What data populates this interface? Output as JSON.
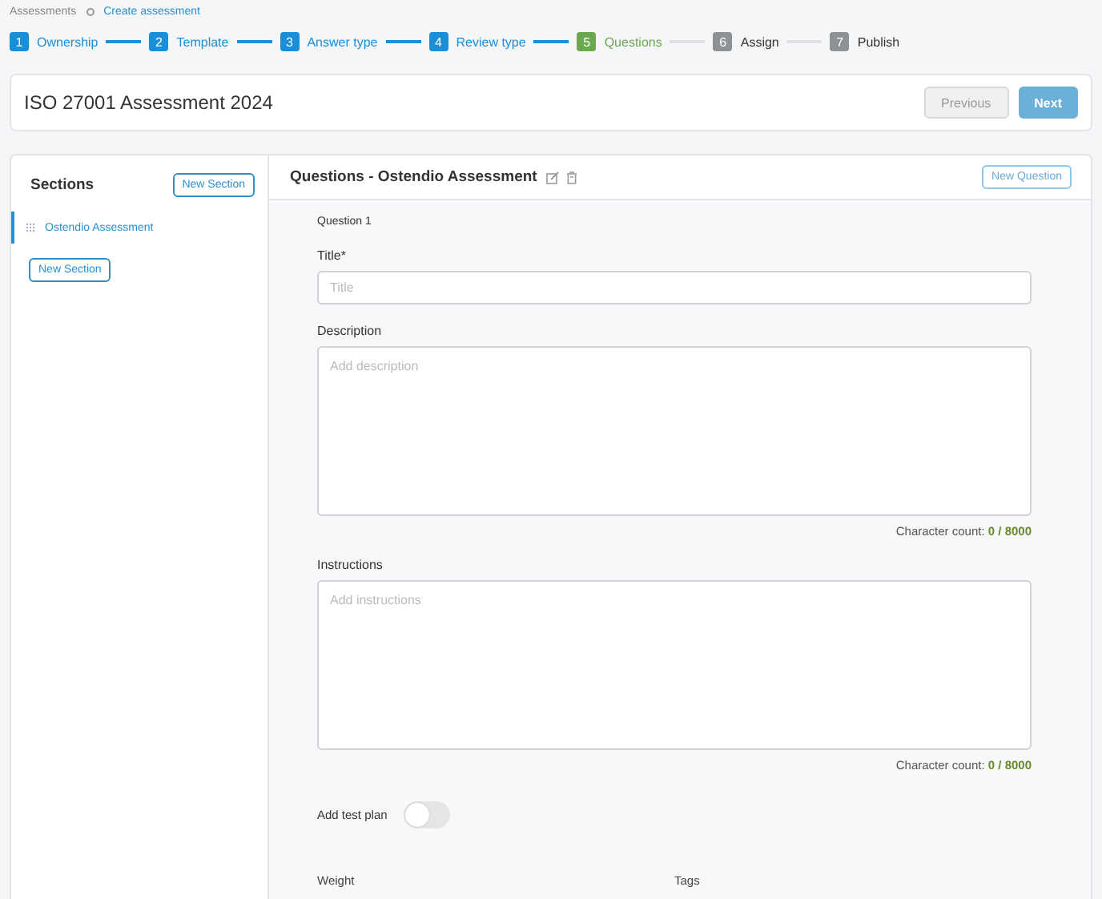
{
  "breadcrumb": [
    {
      "label": "Assessments",
      "kind": "link_muted"
    },
    {
      "label": "Create assessment",
      "kind": "link"
    }
  ],
  "steps": [
    {
      "number": "1",
      "label": "Ownership",
      "kind": "done"
    },
    {
      "number": "2",
      "label": "Template",
      "kind": "done"
    },
    {
      "number": "3",
      "label": "Answer type",
      "kind": "done"
    },
    {
      "number": "4",
      "label": "Review type",
      "kind": "done"
    },
    {
      "number": "5",
      "label": "Questions",
      "kind": "current"
    },
    {
      "number": "6",
      "label": "Assign",
      "kind": "pending"
    },
    {
      "number": "7",
      "label": "Publish",
      "kind": "pending"
    }
  ],
  "header": {
    "title": "ISO 27001 Assessment 2024",
    "buttons": [
      {
        "label": "Previous",
        "kind": "secondary",
        "disabled": true
      },
      {
        "label": "Next",
        "kind": "primary",
        "disabled": true
      }
    ]
  },
  "sections": {
    "title": "Sections",
    "new_button": "New Section",
    "items": [
      {
        "label": "Ostendio Assessment",
        "selected": true
      }
    ],
    "bottom_button": "New Section"
  },
  "questions": {
    "title": "Questions - Ostendio Assessment",
    "new_button": "New Question",
    "question_label": "Question 1",
    "fields": [
      {
        "kind": "input",
        "label": "Title*",
        "placeholder": "Title"
      },
      {
        "kind": "textarea",
        "label": "Description",
        "placeholder": "Add description",
        "count": "Character count: **0 / 8000**"
      },
      {
        "kind": "textarea",
        "label": "Instructions",
        "placeholder": "Add instructions",
        "count": "Character count: **0 / 8000**"
      }
    ],
    "toggle": {
      "label": "Add test plan",
      "on": false
    },
    "bottom_labels": [
      "Weight",
      "Tags"
    ]
  }
}
